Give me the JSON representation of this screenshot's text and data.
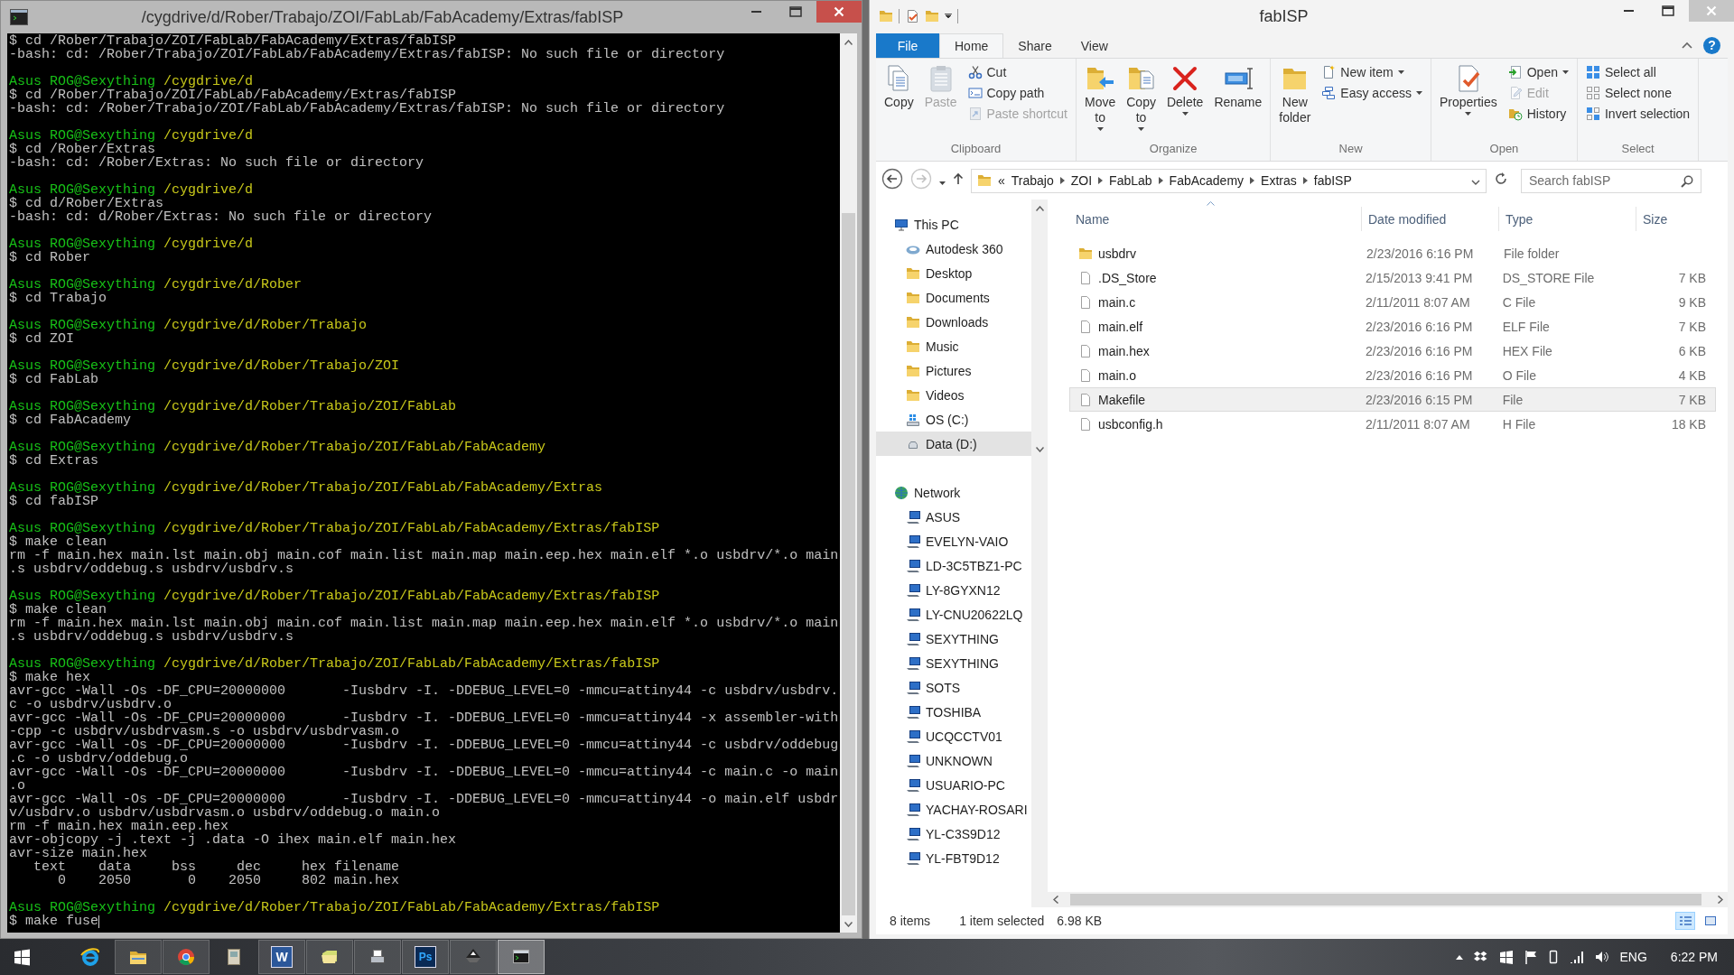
{
  "terminal": {
    "title": "/cygdrive/d/Rober/Trabajo/ZOI/FabLab/FabAcademy/Extras/fabISP",
    "lines": [
      {
        "kind": "text",
        "text": "$ cd /Rober/Trabajo/ZOI/FabLab/FabAcademy/Extras/fabISP"
      },
      {
        "kind": "text",
        "text": "-bash: cd: /Rober/Trabajo/ZOI/FabLab/FabAcademy/Extras/fabISP: No such file or directory"
      },
      {
        "kind": "blank"
      },
      {
        "kind": "prompt",
        "user": "Asus ROG@Sexything",
        "path": "/cygdrive/d"
      },
      {
        "kind": "text",
        "text": "$ cd /Rober/Trabajo/ZOI/FabLab/FabAcademy/Extras/fabISP"
      },
      {
        "kind": "text",
        "text": "-bash: cd: /Rober/Trabajo/ZOI/FabLab/FabAcademy/Extras/fabISP: No such file or directory"
      },
      {
        "kind": "blank"
      },
      {
        "kind": "prompt",
        "user": "Asus ROG@Sexything",
        "path": "/cygdrive/d"
      },
      {
        "kind": "text",
        "text": "$ cd /Rober/Extras"
      },
      {
        "kind": "text",
        "text": "-bash: cd: /Rober/Extras: No such file or directory"
      },
      {
        "kind": "blank"
      },
      {
        "kind": "prompt",
        "user": "Asus ROG@Sexything",
        "path": "/cygdrive/d"
      },
      {
        "kind": "text",
        "text": "$ cd d/Rober/Extras"
      },
      {
        "kind": "text",
        "text": "-bash: cd: d/Rober/Extras: No such file or directory"
      },
      {
        "kind": "blank"
      },
      {
        "kind": "prompt",
        "user": "Asus ROG@Sexything",
        "path": "/cygdrive/d"
      },
      {
        "kind": "text",
        "text": "$ cd Rober"
      },
      {
        "kind": "blank"
      },
      {
        "kind": "prompt",
        "user": "Asus ROG@Sexything",
        "path": "/cygdrive/d/Rober"
      },
      {
        "kind": "text",
        "text": "$ cd Trabajo"
      },
      {
        "kind": "blank"
      },
      {
        "kind": "prompt",
        "user": "Asus ROG@Sexything",
        "path": "/cygdrive/d/Rober/Trabajo"
      },
      {
        "kind": "text",
        "text": "$ cd ZOI"
      },
      {
        "kind": "blank"
      },
      {
        "kind": "prompt",
        "user": "Asus ROG@Sexything",
        "path": "/cygdrive/d/Rober/Trabajo/ZOI"
      },
      {
        "kind": "text",
        "text": "$ cd FabLab"
      },
      {
        "kind": "blank"
      },
      {
        "kind": "prompt",
        "user": "Asus ROG@Sexything",
        "path": "/cygdrive/d/Rober/Trabajo/ZOI/FabLab"
      },
      {
        "kind": "text",
        "text": "$ cd FabAcademy"
      },
      {
        "kind": "blank"
      },
      {
        "kind": "prompt",
        "user": "Asus ROG@Sexything",
        "path": "/cygdrive/d/Rober/Trabajo/ZOI/FabLab/FabAcademy"
      },
      {
        "kind": "text",
        "text": "$ cd Extras"
      },
      {
        "kind": "blank"
      },
      {
        "kind": "prompt",
        "user": "Asus ROG@Sexything",
        "path": "/cygdrive/d/Rober/Trabajo/ZOI/FabLab/FabAcademy/Extras"
      },
      {
        "kind": "text",
        "text": "$ cd fabISP"
      },
      {
        "kind": "blank"
      },
      {
        "kind": "prompt",
        "user": "Asus ROG@Sexything",
        "path": "/cygdrive/d/Rober/Trabajo/ZOI/FabLab/FabAcademy/Extras/fabISP"
      },
      {
        "kind": "text",
        "text": "$ make clean"
      },
      {
        "kind": "text",
        "text": "rm -f main.hex main.lst main.obj main.cof main.list main.map main.eep.hex main.elf *.o usbdrv/*.o main"
      },
      {
        "kind": "text",
        "text": ".s usbdrv/oddebug.s usbdrv/usbdrv.s"
      },
      {
        "kind": "blank"
      },
      {
        "kind": "prompt",
        "user": "Asus ROG@Sexything",
        "path": "/cygdrive/d/Rober/Trabajo/ZOI/FabLab/FabAcademy/Extras/fabISP"
      },
      {
        "kind": "text",
        "text": "$ make clean"
      },
      {
        "kind": "text",
        "text": "rm -f main.hex main.lst main.obj main.cof main.list main.map main.eep.hex main.elf *.o usbdrv/*.o main"
      },
      {
        "kind": "text",
        "text": ".s usbdrv/oddebug.s usbdrv/usbdrv.s"
      },
      {
        "kind": "blank"
      },
      {
        "kind": "prompt",
        "user": "Asus ROG@Sexything",
        "path": "/cygdrive/d/Rober/Trabajo/ZOI/FabLab/FabAcademy/Extras/fabISP"
      },
      {
        "kind": "text",
        "text": "$ make hex"
      },
      {
        "kind": "text",
        "text": "avr-gcc -Wall -Os -DF_CPU=20000000       -Iusbdrv -I. -DDEBUG_LEVEL=0 -mmcu=attiny44 -c usbdrv/usbdrv."
      },
      {
        "kind": "text",
        "text": "c -o usbdrv/usbdrv.o"
      },
      {
        "kind": "text",
        "text": "avr-gcc -Wall -Os -DF_CPU=20000000       -Iusbdrv -I. -DDEBUG_LEVEL=0 -mmcu=attiny44 -x assembler-with"
      },
      {
        "kind": "text",
        "text": "-cpp -c usbdrv/usbdrvasm.s -o usbdrv/usbdrvasm.o"
      },
      {
        "kind": "text",
        "text": "avr-gcc -Wall -Os -DF_CPU=20000000       -Iusbdrv -I. -DDEBUG_LEVEL=0 -mmcu=attiny44 -c usbdrv/oddebug"
      },
      {
        "kind": "text",
        "text": ".c -o usbdrv/oddebug.o"
      },
      {
        "kind": "text",
        "text": "avr-gcc -Wall -Os -DF_CPU=20000000       -Iusbdrv -I. -DDEBUG_LEVEL=0 -mmcu=attiny44 -c main.c -o main"
      },
      {
        "kind": "text",
        "text": ".o"
      },
      {
        "kind": "text",
        "text": "avr-gcc -Wall -Os -DF_CPU=20000000       -Iusbdrv -I. -DDEBUG_LEVEL=0 -mmcu=attiny44 -o main.elf usbdr"
      },
      {
        "kind": "text",
        "text": "v/usbdrv.o usbdrv/usbdrvasm.o usbdrv/oddebug.o main.o"
      },
      {
        "kind": "text",
        "text": "rm -f main.hex main.eep.hex"
      },
      {
        "kind": "text",
        "text": "avr-objcopy -j .text -j .data -O ihex main.elf main.hex"
      },
      {
        "kind": "text",
        "text": "avr-size main.hex"
      },
      {
        "kind": "text",
        "text": "   text    data     bss     dec     hex filename"
      },
      {
        "kind": "text",
        "text": "      0    2050       0    2050     802 main.hex"
      },
      {
        "kind": "blank"
      },
      {
        "kind": "prompt",
        "user": "Asus ROG@Sexything",
        "path": "/cygdrive/d/Rober/Trabajo/ZOI/FabLab/FabAcademy/Extras/fabISP"
      },
      {
        "kind": "text",
        "text": "$ make fuse"
      }
    ]
  },
  "explorer": {
    "title": "fabISP",
    "tabs": [
      {
        "kind": "menu",
        "label": "File",
        "selected": false
      },
      {
        "kind": "tab",
        "label": "Home",
        "selected": true
      },
      {
        "kind": "tab",
        "label": "Share",
        "selected": false
      },
      {
        "kind": "tab",
        "label": "View",
        "selected": false
      }
    ],
    "help": "?",
    "ribbon": [
      {
        "label": "Clipboard",
        "buttons": [
          {
            "kind": "large",
            "label": "Copy",
            "disabled": false,
            "dropdown": false
          },
          {
            "kind": "large",
            "label": "Paste",
            "disabled": true,
            "dropdown": false
          },
          {
            "kind": "small",
            "label": "Cut",
            "disabled": false,
            "dropdown": false
          },
          {
            "kind": "small",
            "label": "Copy path",
            "disabled": false,
            "dropdown": false
          },
          {
            "kind": "small",
            "label": "Paste shortcut",
            "disabled": true,
            "dropdown": false
          }
        ]
      },
      {
        "label": "Organize",
        "buttons": [
          {
            "kind": "large",
            "label": "Move to",
            "disabled": false,
            "dropdown": true
          },
          {
            "kind": "large",
            "label": "Copy to",
            "disabled": false,
            "dropdown": true
          },
          {
            "kind": "large",
            "label": "Delete",
            "disabled": false,
            "dropdown": true
          },
          {
            "kind": "large",
            "label": "Rename",
            "disabled": false,
            "dropdown": false
          }
        ]
      },
      {
        "label": "New",
        "buttons": [
          {
            "kind": "large",
            "label": "New folder",
            "disabled": false,
            "dropdown": false
          },
          {
            "kind": "small",
            "label": "New item",
            "disabled": false,
            "dropdown": true
          },
          {
            "kind": "small",
            "label": "Easy access",
            "disabled": false,
            "dropdown": true
          }
        ]
      },
      {
        "label": "Open",
        "buttons": [
          {
            "kind": "large",
            "label": "Properties",
            "disabled": false,
            "dropdown": true
          },
          {
            "kind": "small",
            "label": "Open",
            "disabled": false,
            "dropdown": true
          },
          {
            "kind": "small",
            "label": "Edit",
            "disabled": true,
            "dropdown": false
          },
          {
            "kind": "small",
            "label": "History",
            "disabled": false,
            "dropdown": false
          }
        ]
      },
      {
        "label": "Select",
        "buttons": [
          {
            "kind": "small",
            "label": "Select all",
            "disabled": false,
            "dropdown": false
          },
          {
            "kind": "small",
            "label": "Select none",
            "disabled": false,
            "dropdown": false
          },
          {
            "kind": "small",
            "label": "Invert selection",
            "disabled": false,
            "dropdown": false
          }
        ]
      }
    ],
    "address": {
      "overflow": "«",
      "crumbs": [
        "Trabajo",
        "ZOI",
        "FabLab",
        "FabAcademy",
        "Extras",
        "fabISP"
      ],
      "search": {
        "placeholder": "Search fabISP"
      }
    },
    "nav": [
      {
        "kind": "pc",
        "label": "This PC",
        "selected": false,
        "children": [
          {
            "kind": "cloud",
            "label": "Autodesk 360",
            "selected": false
          },
          {
            "kind": "folder",
            "label": "Desktop",
            "selected": false
          },
          {
            "kind": "folder",
            "label": "Documents",
            "selected": false
          },
          {
            "kind": "folder",
            "label": "Downloads",
            "selected": false
          },
          {
            "kind": "folder",
            "label": "Music",
            "selected": false
          },
          {
            "kind": "folder",
            "label": "Pictures",
            "selected": false
          },
          {
            "kind": "folder",
            "label": "Videos",
            "selected": false
          },
          {
            "kind": "drive_system",
            "label": "OS (C:)",
            "selected": false
          },
          {
            "kind": "drive",
            "label": "Data (D:)",
            "selected": true
          }
        ]
      },
      {
        "kind": "network",
        "label": "Network",
        "selected": false,
        "children": [
          {
            "kind": "computer",
            "label": "ASUS",
            "selected": false
          },
          {
            "kind": "computer",
            "label": "EVELYN-VAIO",
            "selected": false
          },
          {
            "kind": "computer",
            "label": "LD-3C5TBZ1-PC",
            "selected": false
          },
          {
            "kind": "computer",
            "label": "LY-8GYXN12",
            "selected": false
          },
          {
            "kind": "computer",
            "label": "LY-CNU20622LQ",
            "selected": false
          },
          {
            "kind": "computer",
            "label": "SEXYTHING",
            "selected": false
          },
          {
            "kind": "computer",
            "label": "SEXYTHING",
            "selected": false
          },
          {
            "kind": "computer",
            "label": "SOTS",
            "selected": false
          },
          {
            "kind": "computer",
            "label": "TOSHIBA",
            "selected": false
          },
          {
            "kind": "computer",
            "label": "UCQCCTV01",
            "selected": false
          },
          {
            "kind": "computer",
            "label": "UNKNOWN",
            "selected": false
          },
          {
            "kind": "computer",
            "label": "USUARIO-PC",
            "selected": false
          },
          {
            "kind": "computer",
            "label": "YACHAY-ROSARI",
            "selected": false
          },
          {
            "kind": "computer",
            "label": "YL-C3S9D12",
            "selected": false
          },
          {
            "kind": "computer",
            "label": "YL-FBT9D12",
            "selected": false
          }
        ]
      }
    ],
    "columns": [
      "Name",
      "Date modified",
      "Type",
      "Size"
    ],
    "files": [
      {
        "kind": "folder",
        "name": "usbdrv",
        "date": "2/23/2016 6:16 PM",
        "type": "File folder",
        "selected": false
      },
      {
        "kind": "file",
        "name": ".DS_Store",
        "date": "2/15/2013 9:41 PM",
        "type": "DS_STORE File",
        "size": "7 KB",
        "selected": false
      },
      {
        "kind": "file",
        "name": "main.c",
        "date": "2/11/2011 8:07 AM",
        "type": "C File",
        "size": "9 KB",
        "selected": false
      },
      {
        "kind": "file",
        "name": "main.elf",
        "date": "2/23/2016 6:16 PM",
        "type": "ELF File",
        "size": "7 KB",
        "selected": false
      },
      {
        "kind": "file",
        "name": "main.hex",
        "date": "2/23/2016 6:16 PM",
        "type": "HEX File",
        "size": "6 KB",
        "selected": false
      },
      {
        "kind": "file",
        "name": "main.o",
        "date": "2/23/2016 6:16 PM",
        "type": "O File",
        "size": "4 KB",
        "selected": false
      },
      {
        "kind": "file",
        "name": "Makefile",
        "date": "2/23/2016 6:15 PM",
        "type": "File",
        "size": "7 KB",
        "selected": true
      },
      {
        "kind": "file",
        "name": "usbconfig.h",
        "date": "2/11/2011 8:07 AM",
        "type": "H File",
        "size": "18 KB",
        "selected": false
      }
    ],
    "status": {
      "items": "8 items",
      "selection": "1 item selected",
      "size": "6.98 KB"
    },
    "views": [
      {
        "kind": "details",
        "selected": true
      },
      {
        "kind": "large_icons",
        "selected": false
      }
    ]
  },
  "taskbar": {
    "apps": [
      {
        "running": false,
        "selected": false
      },
      {
        "running": true,
        "selected": false
      },
      {
        "running": true,
        "selected": false
      },
      {
        "running": false,
        "selected": false
      },
      {
        "running": true,
        "selected": false,
        "glyph": "W"
      },
      {
        "running": true,
        "selected": false
      },
      {
        "running": true,
        "selected": false
      },
      {
        "running": true,
        "selected": false,
        "glyph": "Ps"
      },
      {
        "running": true,
        "selected": false
      },
      {
        "running": true,
        "selected": true
      }
    ],
    "language": "ENG",
    "time": "6:22 PM"
  }
}
